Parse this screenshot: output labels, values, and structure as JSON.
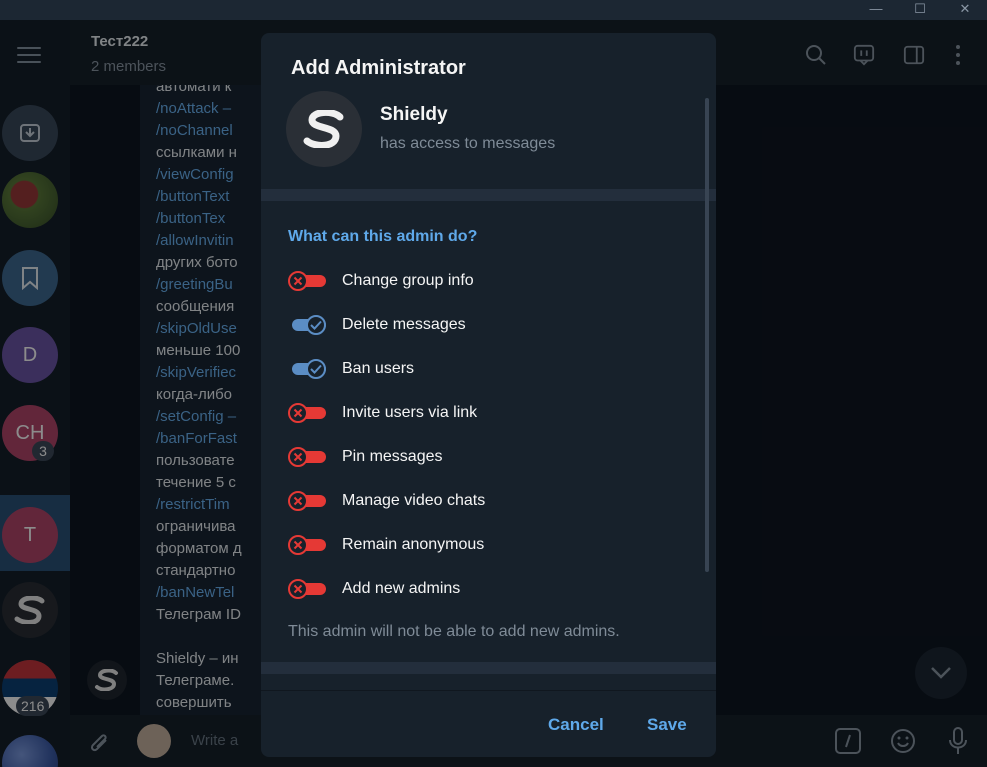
{
  "chat": {
    "title": "Тест222",
    "subtitle": "2 members",
    "composer_placeholder": "Write a",
    "messages": [
      {
        "text": "автомати к",
        "type": "text"
      },
      {
        "text": "/noAttack –",
        "type": "cmd"
      },
      {
        "text": "/noChannel",
        "type": "cmd"
      },
      {
        "text": "ссылками н",
        "type": "text"
      },
      {
        "text": "/viewConfig",
        "type": "cmd"
      },
      {
        "text": "/buttonText",
        "type": "cmd"
      },
      {
        "text": "/buttonTex",
        "type": "cmd"
      },
      {
        "text": "/allowInvitin",
        "type": "cmd"
      },
      {
        "text": "других бото",
        "type": "text"
      },
      {
        "text": "/greetingBu",
        "type": "cmd"
      },
      {
        "text": "сообщения",
        "type": "text"
      },
      {
        "text": "/skipOldUse",
        "type": "cmd"
      },
      {
        "text": "меньше 100",
        "type": "text"
      },
      {
        "text": "/skipVerifiec",
        "type": "cmd"
      },
      {
        "text": "когда-либо",
        "type": "text"
      },
      {
        "text": "/setConfig –",
        "type": "cmd"
      },
      {
        "text": "/banForFast",
        "type": "cmd"
      },
      {
        "text": "пользовате",
        "type": "text"
      },
      {
        "text": "течение 5 с",
        "type": "text"
      },
      {
        "text": "/restrictTim",
        "type": "cmd"
      },
      {
        "text": "ограничива",
        "type": "text"
      },
      {
        "text": "форматом д",
        "type": "text"
      },
      {
        "text": "стандартно",
        "type": "text"
      },
      {
        "text": "/banNewTel",
        "type": "cmd"
      },
      {
        "text": "Телеграм ID",
        "type": "text"
      },
      {
        "text": "",
        "type": "text"
      },
      {
        "text": "Shieldy – ин",
        "type": "text"
      },
      {
        "text": "Телеграме.",
        "type": "text"
      },
      {
        "text": "совершить",
        "type": "text"
      }
    ]
  },
  "rail": {
    "chats": [
      {
        "name": "archive",
        "letter": "",
        "color": "#3a4a5c",
        "badge": ""
      },
      {
        "name": "photo-contact",
        "letter": "",
        "color": "#4a6a3a",
        "badge": ""
      },
      {
        "name": "saved-messages",
        "letter": "",
        "color": "#3e6b93",
        "badge": ""
      },
      {
        "name": "chat-d",
        "letter": "D",
        "color": "#6c56a8",
        "badge": ""
      },
      {
        "name": "chat-ch",
        "letter": "CH",
        "color": "#b3466b",
        "badge": "3"
      },
      {
        "name": "chat-t",
        "letter": "T",
        "color": "#b3466b",
        "badge": ""
      },
      {
        "name": "shieldy",
        "letter": "",
        "color": "#2a2f36",
        "badge": ""
      },
      {
        "name": "serbia",
        "letter": "",
        "color": "#c6363c",
        "badge": "216"
      },
      {
        "name": "globe",
        "letter": "",
        "color": "#3b5ba8",
        "badge": ""
      }
    ]
  },
  "modal": {
    "title": "Add Administrator",
    "bot_name": "Shieldy",
    "bot_status": "has access to messages",
    "section_title": "What can this admin do?",
    "permissions": [
      {
        "label": "Change group info",
        "enabled": false
      },
      {
        "label": "Delete messages",
        "enabled": true
      },
      {
        "label": "Ban users",
        "enabled": true
      },
      {
        "label": "Invite users via link",
        "enabled": false
      },
      {
        "label": "Pin messages",
        "enabled": false
      },
      {
        "label": "Manage video chats",
        "enabled": false
      },
      {
        "label": "Remain anonymous",
        "enabled": false
      },
      {
        "label": "Add new admins",
        "enabled": false
      }
    ],
    "note": "This admin will not be able to add new admins.",
    "cancel_label": "Cancel",
    "save_label": "Save"
  },
  "colors": {
    "accent": "#5fa9ea",
    "toggle_on": "#5b8dc4",
    "toggle_off": "#e53935"
  }
}
